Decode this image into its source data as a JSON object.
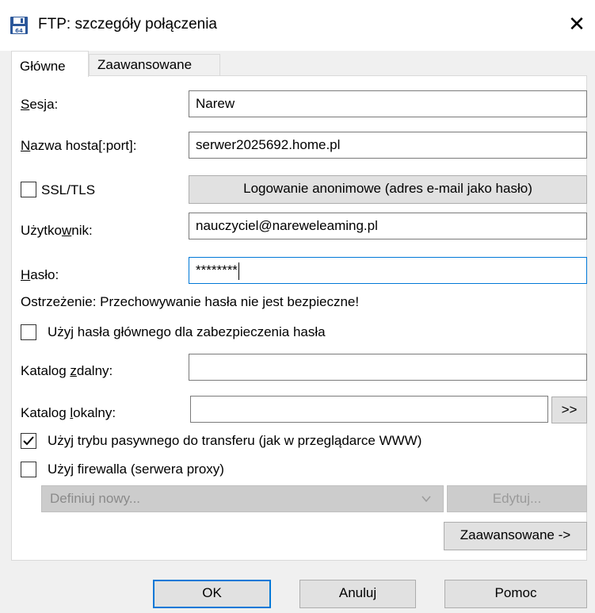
{
  "window": {
    "title": "FTP: szczegóły połączenia",
    "close_glyph": "✕",
    "icon": "floppy-disk-icon"
  },
  "tabs": [
    {
      "label": "Główne",
      "active": true
    },
    {
      "label": "Zaawansowane",
      "active": false
    }
  ],
  "form": {
    "session": {
      "label_underline": "S",
      "label_rest": "esja:",
      "value": "Narew"
    },
    "host": {
      "label_underline": "N",
      "label_rest": "azwa hosta[:port]:",
      "value": "serwer2025692.home.pl"
    },
    "ssl": {
      "label": "SSL/TLS",
      "checked": false
    },
    "anon_button": "Logowanie anonimowe (adres e-mail jako hasło)",
    "user": {
      "label_pre": "Użytko",
      "label_underline": "w",
      "label_rest": "nik:",
      "value": "nauczyciel@nareweleaming.pl"
    },
    "password": {
      "label_underline": "H",
      "label_rest": "asło:",
      "value": "********"
    },
    "warning": "Ostrzeżenie: Przechowywanie hasła nie jest bezpieczne!",
    "master_password": {
      "label": "Użyj hasła głównego dla zabezpieczenia hasła",
      "checked": false
    },
    "remote_dir": {
      "label_pre": "Katalog ",
      "label_underline": "z",
      "label_rest": "dalny:",
      "value": ""
    },
    "local_dir": {
      "label_pre": "Katalog ",
      "label_underline": "l",
      "label_rest": "okalny:",
      "value": "",
      "browse_label": ">>"
    },
    "passive": {
      "label": "Użyj trybu pasywnego do transferu (jak w przeglądarce WWW)",
      "checked": true
    },
    "firewall": {
      "label": "Użyj firewalla (serwera proxy)",
      "checked": false
    },
    "proxy_select": {
      "value": "Definiuj nowy..."
    },
    "edit_button": "Edytuj...",
    "advanced_button": "Zaawansowane ->"
  },
  "footer": {
    "ok": "OK",
    "cancel": "Anuluj",
    "help": "Pomoc"
  },
  "colors": {
    "accent": "#0078d7",
    "dialog_bg": "#f0f0f0",
    "disabled_bg": "#cccccc"
  }
}
